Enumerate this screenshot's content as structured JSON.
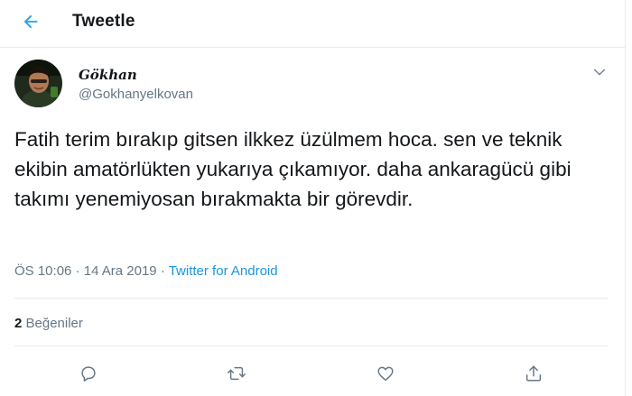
{
  "header": {
    "title": "Tweetle"
  },
  "tweet": {
    "display_name": "Gökhan",
    "handle": "@Gokhanyelkovan",
    "text": "Fatih terim bırakıp gitsen ilkkez üzülmem hoca. sen ve teknik ekibin amatörlükten yukarıya çıkamıyor. daha ankaragücü gibi takımı yenemiyosan bırakmakta bir görevdir.",
    "time": "ÖS 10:06",
    "date": "14 Ara 2019",
    "dot": "·",
    "source": "Twitter for Android",
    "likes_count": "2",
    "likes_label": "Beğeniler"
  },
  "colors": {
    "accent": "#1da1f2",
    "secondary_text": "#657786",
    "divider": "#e6ecf0"
  },
  "icons": {
    "back": "arrow-left-icon",
    "more": "chevron-down-icon",
    "reply": "reply-icon",
    "retweet": "retweet-icon",
    "like": "heart-icon",
    "share": "share-icon"
  }
}
